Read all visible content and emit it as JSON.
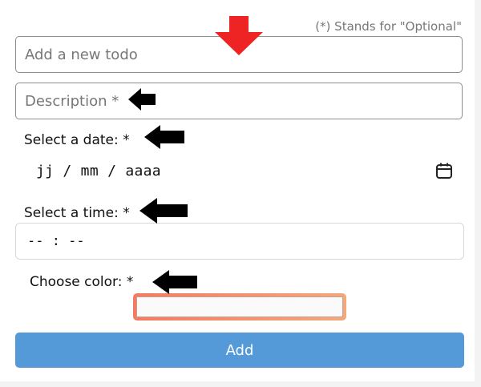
{
  "form": {
    "optional_note": "(*) Stands for \"Optional\"",
    "todo_placeholder": "Add a new todo",
    "description_placeholder": "Description *",
    "date_label": "Select a date: *",
    "date_placeholder": "jj / mm / aaaa",
    "time_label": "Select a time: *",
    "time_placeholder": "-- : --",
    "color_label": "Choose color: *",
    "add_label": "Add"
  },
  "colors": {
    "add_button": "#5499d8",
    "color_swatch_border": "#f47a62",
    "red_arrow": "#ee2424",
    "black_arrow": "#000000"
  },
  "icons": {
    "date_picker": "calendar-icon",
    "annotations": [
      "red-down-arrow-icon",
      "black-left-arrow-icon"
    ]
  }
}
